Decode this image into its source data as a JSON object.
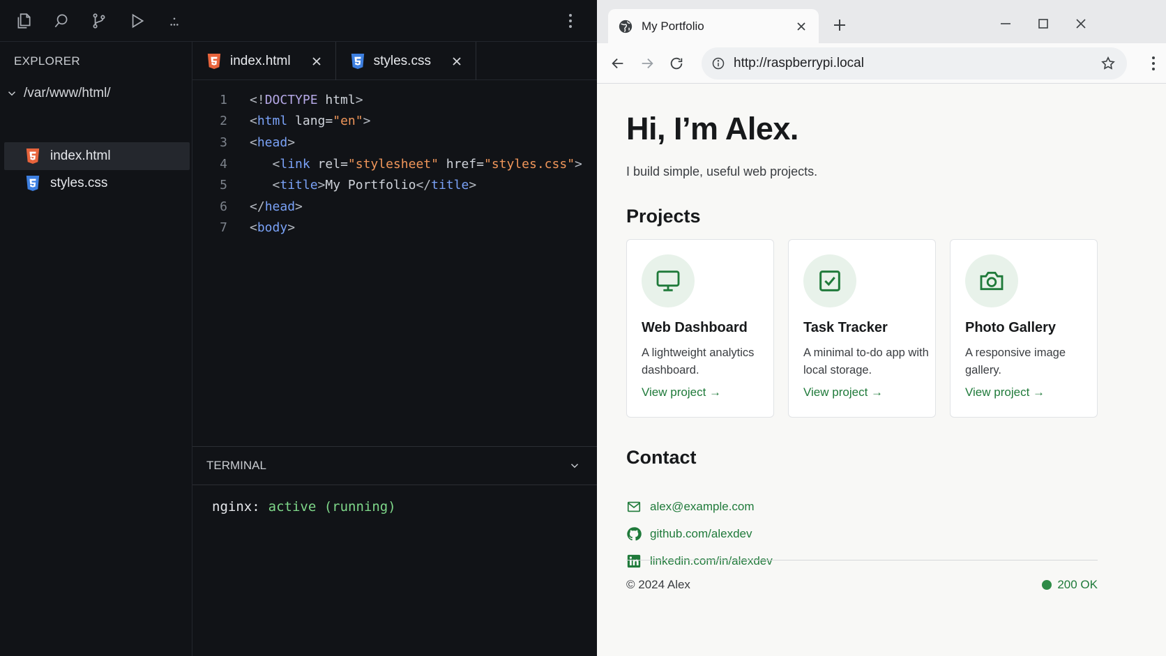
{
  "editor": {
    "explorer_title": "EXPLORER",
    "folder": "/var/www/html/",
    "files": [
      {
        "name": "index.html",
        "type": "html",
        "active": true
      },
      {
        "name": "styles.css",
        "type": "css",
        "active": false
      }
    ],
    "tabs": [
      {
        "label": "index.html",
        "type": "html"
      },
      {
        "label": "styles.css",
        "type": "css"
      }
    ],
    "code_lines": [
      {
        "n": "1",
        "parts": [
          [
            "punct",
            "<!"
          ],
          [
            "kw",
            "DOCTYPE"
          ],
          [
            "attr",
            " html"
          ],
          [
            "punct",
            ">"
          ]
        ]
      },
      {
        "n": "2",
        "parts": [
          [
            "punct",
            "<"
          ],
          [
            "tag",
            "html"
          ],
          [
            "attr",
            " lang="
          ],
          [
            "str",
            "\"en\""
          ],
          [
            "punct",
            ">"
          ]
        ]
      },
      {
        "n": "3",
        "parts": [
          [
            "punct",
            "<"
          ],
          [
            "tag",
            "head"
          ],
          [
            "punct",
            ">"
          ]
        ]
      },
      {
        "n": "4",
        "parts": [
          [
            "attr",
            "   "
          ],
          [
            "punct",
            "<"
          ],
          [
            "tag",
            "link"
          ],
          [
            "attr",
            " rel="
          ],
          [
            "str",
            "\"stylesheet\""
          ],
          [
            "attr",
            " href="
          ],
          [
            "str",
            "\"styles.css\""
          ],
          [
            "punct",
            ">"
          ]
        ]
      },
      {
        "n": "5",
        "parts": [
          [
            "attr",
            "   "
          ],
          [
            "punct",
            "<"
          ],
          [
            "tag",
            "title"
          ],
          [
            "punct",
            ">"
          ],
          [
            "attr",
            "My Portfolio"
          ],
          [
            "punct",
            "</"
          ],
          [
            "tag",
            "title"
          ],
          [
            "punct",
            ">"
          ]
        ]
      },
      {
        "n": "6",
        "parts": [
          [
            "punct",
            "</"
          ],
          [
            "tag",
            "head"
          ],
          [
            "punct",
            ">"
          ]
        ]
      },
      {
        "n": "7",
        "parts": [
          [
            "punct",
            "<"
          ],
          [
            "tag",
            "body"
          ],
          [
            "punct",
            ">"
          ]
        ]
      }
    ],
    "terminal": {
      "title": "TERMINAL",
      "service": "nginx:",
      "status": "active (running)"
    }
  },
  "browser": {
    "tab_title": "My Portfolio",
    "url": "http://raspberrypi.local",
    "page": {
      "hero_title": "Hi, I’m Alex.",
      "hero_sub": "I build simple, useful web projects.",
      "projects_title": "Projects",
      "projects": [
        {
          "icon": "monitor-icon",
          "title": "Web Dashboard",
          "desc": "A lightweight analytics dashboard.",
          "link": "View project →"
        },
        {
          "icon": "checkbox-icon",
          "title": "Task Tracker",
          "desc": "A minimal to-do app with local storage.",
          "link": "View project →"
        },
        {
          "icon": "camera-icon",
          "title": "Photo Gallery",
          "desc": "A responsive image gallery.",
          "link": "View project →"
        }
      ],
      "contact_title": "Contact",
      "contacts": [
        {
          "icon": "mail-icon",
          "text": "alex@example.com"
        },
        {
          "icon": "github-icon",
          "text": "github.com/alexdev"
        },
        {
          "icon": "linkedin-icon",
          "text": "linkedin.com/in/alexdev"
        }
      ],
      "footer_copy": "© 2024 Alex",
      "footer_status": "200 OK"
    }
  },
  "colors": {
    "accent_green": "#1f7a3a",
    "html_orange": "#e8643c",
    "css_blue": "#3d7fe0"
  }
}
